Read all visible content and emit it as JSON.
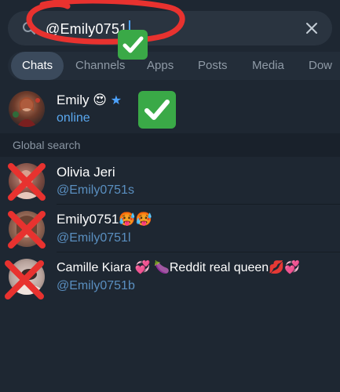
{
  "search": {
    "query": "@Emily0751"
  },
  "tabs": [
    {
      "label": "Chats",
      "active": true
    },
    {
      "label": "Channels",
      "active": false
    },
    {
      "label": "Apps",
      "active": false
    },
    {
      "label": "Posts",
      "active": false
    },
    {
      "label": "Media",
      "active": false
    },
    {
      "label": "Dow",
      "active": false
    }
  ],
  "top_result": {
    "name": "Emily 😍",
    "status": "online"
  },
  "global_search": {
    "title": "Global search",
    "results": [
      {
        "name": "Olivia Jeri",
        "handle": "@Emily0751s"
      },
      {
        "name": "Emily0751🥵🥵",
        "handle": "@Emily0751l"
      },
      {
        "name": "Camille Kiara 💞 🍆Reddit real queen💋💞",
        "handle": "@Emily0751b"
      }
    ]
  },
  "colors": {
    "background": "#1e2732",
    "accent": "#5aa8ef",
    "annotation_red": "#e8322f",
    "annotation_green": "#3aa947"
  }
}
